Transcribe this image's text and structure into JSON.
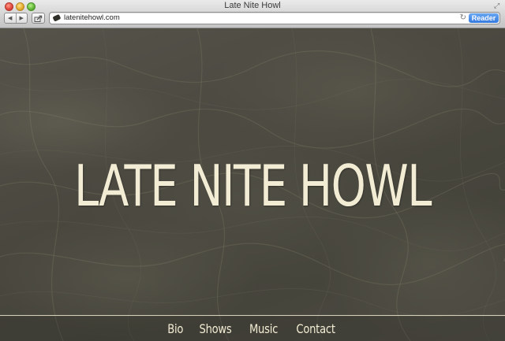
{
  "browser": {
    "window_title": "Late Nite Howl",
    "url": "latenitehowl.com",
    "reader_label": "Reader",
    "back_glyph": "◀",
    "forward_glyph": "▶",
    "reload_glyph": "↻",
    "fullscreen_glyph": "⤢"
  },
  "page": {
    "hero_title": "LATE NITE HOWL",
    "nav": [
      {
        "label": "Bio"
      },
      {
        "label": "Shows"
      },
      {
        "label": "Music"
      },
      {
        "label": "Contact"
      }
    ]
  },
  "colors": {
    "text_cream": "#f2ecd4",
    "background_dark": "#4a483f",
    "reader_blue": "#3479de"
  },
  "icons": {
    "back": "back-arrow-icon",
    "forward": "forward-arrow-icon",
    "share": "share-icon",
    "site": "site-favicon-icon",
    "reload": "reload-icon",
    "fullscreen": "fullscreen-icon"
  }
}
